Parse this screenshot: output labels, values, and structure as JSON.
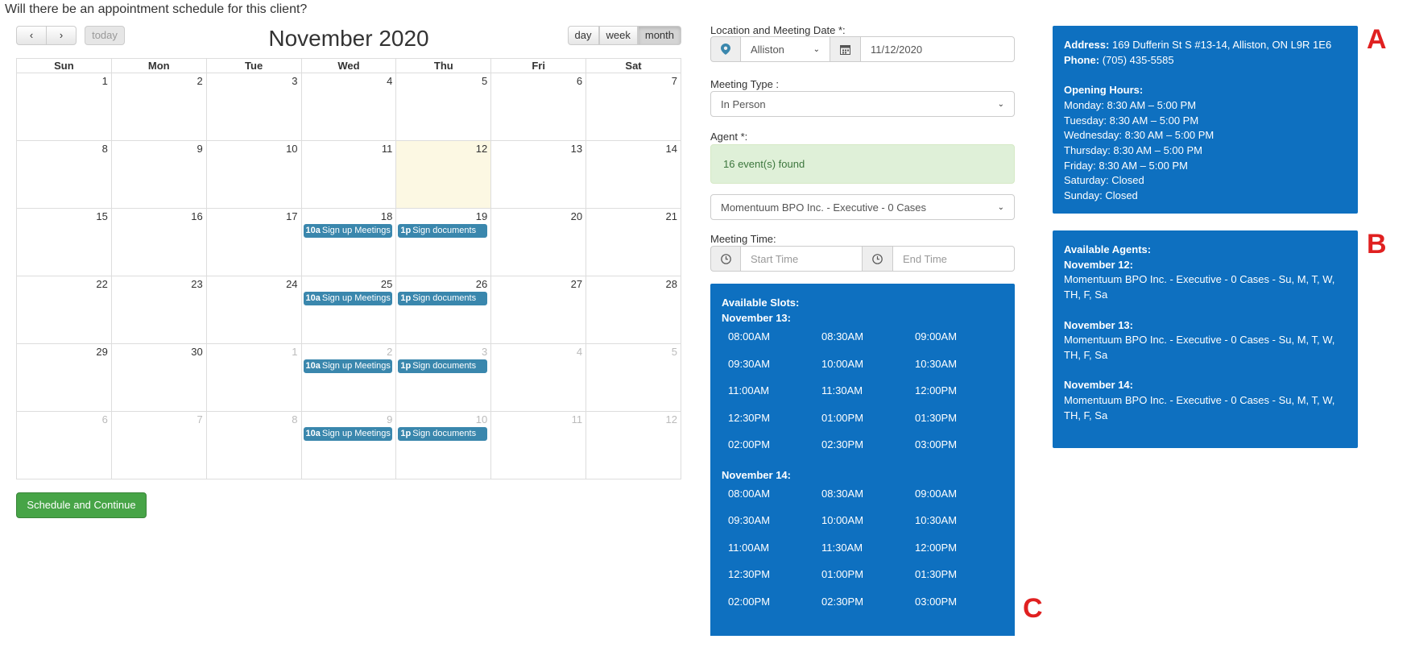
{
  "question": "Will there be an appointment schedule for this client?",
  "calendar": {
    "title": "November 2020",
    "today_label": "today",
    "views": [
      "day",
      "week",
      "month"
    ],
    "weekdays": [
      "Sun",
      "Mon",
      "Tue",
      "Wed",
      "Thu",
      "Fri",
      "Sat"
    ],
    "weeks": [
      [
        [
          "1",
          0
        ],
        [
          "2",
          0
        ],
        [
          "3",
          0
        ],
        [
          "4",
          0
        ],
        [
          "5",
          0
        ],
        [
          "6",
          0
        ],
        [
          "7",
          0
        ]
      ],
      [
        [
          "8",
          0
        ],
        [
          "9",
          0
        ],
        [
          "10",
          0
        ],
        [
          "11",
          0
        ],
        [
          "12",
          0
        ],
        [
          "13",
          0
        ],
        [
          "14",
          0
        ]
      ],
      [
        [
          "15",
          0
        ],
        [
          "16",
          0
        ],
        [
          "17",
          0
        ],
        [
          "18",
          0
        ],
        [
          "19",
          0
        ],
        [
          "20",
          0
        ],
        [
          "21",
          0
        ]
      ],
      [
        [
          "22",
          0
        ],
        [
          "23",
          0
        ],
        [
          "24",
          0
        ],
        [
          "25",
          0
        ],
        [
          "26",
          0
        ],
        [
          "27",
          0
        ],
        [
          "28",
          0
        ]
      ],
      [
        [
          "29",
          0
        ],
        [
          "30",
          0
        ],
        [
          "1",
          1
        ],
        [
          "2",
          1
        ],
        [
          "3",
          1
        ],
        [
          "4",
          1
        ],
        [
          "5",
          1
        ]
      ],
      [
        [
          "6",
          1
        ],
        [
          "7",
          1
        ],
        [
          "8",
          1
        ],
        [
          "9",
          1
        ],
        [
          "10",
          1
        ],
        [
          "11",
          1
        ],
        [
          "12",
          1
        ]
      ]
    ],
    "today_cell": [
      1,
      4
    ],
    "events": [
      {
        "week": 2,
        "day": 3,
        "time": "10a",
        "title": "Sign up Meetings"
      },
      {
        "week": 2,
        "day": 4,
        "time": "1p",
        "title": "Sign documents"
      },
      {
        "week": 3,
        "day": 3,
        "time": "10a",
        "title": "Sign up Meetings"
      },
      {
        "week": 3,
        "day": 4,
        "time": "1p",
        "title": "Sign documents"
      },
      {
        "week": 4,
        "day": 3,
        "time": "10a",
        "title": "Sign up Meetings"
      },
      {
        "week": 4,
        "day": 4,
        "time": "1p",
        "title": "Sign documents"
      },
      {
        "week": 5,
        "day": 3,
        "time": "10a",
        "title": "Sign up Meetings"
      },
      {
        "week": 5,
        "day": 4,
        "time": "1p",
        "title": "Sign documents"
      }
    ]
  },
  "schedule_button": "Schedule and Continue",
  "form": {
    "location_label": "Location and Meeting Date *:",
    "location_value": "Alliston",
    "date_value": "11/12/2020",
    "meeting_type_label": "Meeting Type :",
    "meeting_type_value": "In Person",
    "agent_label": "Agent *:",
    "events_found": "16 event(s) found",
    "agent_value": "Momentuum BPO Inc. - Executive - 0 Cases",
    "meeting_time_label": "Meeting Time:",
    "start_placeholder": "Start Time",
    "end_placeholder": "End Time"
  },
  "slots": {
    "heading": "Available Slots:",
    "days": [
      {
        "label": "November 13:",
        "times": [
          "08:00AM",
          "08:30AM",
          "09:00AM",
          "09:30AM",
          "10:00AM",
          "10:30AM",
          "11:00AM",
          "11:30AM",
          "12:00PM",
          "12:30PM",
          "01:00PM",
          "01:30PM",
          "02:00PM",
          "02:30PM",
          "03:00PM"
        ]
      },
      {
        "label": "November 14:",
        "times": [
          "08:00AM",
          "08:30AM",
          "09:00AM",
          "09:30AM",
          "10:00AM",
          "10:30AM",
          "11:00AM",
          "11:30AM",
          "12:00PM",
          "12:30PM",
          "01:00PM",
          "01:30PM",
          "02:00PM",
          "02:30PM",
          "03:00PM"
        ]
      }
    ]
  },
  "office": {
    "address_label": "Address:",
    "address": "169 Dufferin St S #13-14, Alliston, ON L9R 1E6",
    "phone_label": "Phone:",
    "phone": "(705) 435-5585",
    "hours_label": "Opening Hours:",
    "hours": [
      "Monday: 8:30 AM – 5:00 PM",
      "Tuesday: 8:30 AM – 5:00 PM",
      "Wednesday: 8:30 AM – 5:00 PM",
      "Thursday: 8:30 AM – 5:00 PM",
      "Friday: 8:30 AM – 5:00 PM",
      "Saturday: Closed",
      "Sunday: Closed"
    ]
  },
  "agents": {
    "heading": "Available Agents:",
    "days": [
      {
        "label": "November 12:",
        "text": "Momentuum BPO Inc. - Executive - 0 Cases - Su, M, T, W, TH, F, Sa"
      },
      {
        "label": "November 13:",
        "text": "Momentuum BPO Inc. - Executive - 0 Cases - Su, M, T, W, TH, F, Sa"
      },
      {
        "label": "November 14:",
        "text": "Momentuum BPO Inc. - Executive - 0 Cases - Su, M, T, W, TH, F, Sa"
      }
    ]
  },
  "markers": {
    "a": "A",
    "b": "B",
    "c": "C"
  },
  "colors": {
    "panel_blue": "#0e70c0",
    "event_blue": "#3a87ad",
    "today_bg": "#fcf8e3",
    "green_button": "#47a447",
    "marker_red": "#e02020"
  }
}
